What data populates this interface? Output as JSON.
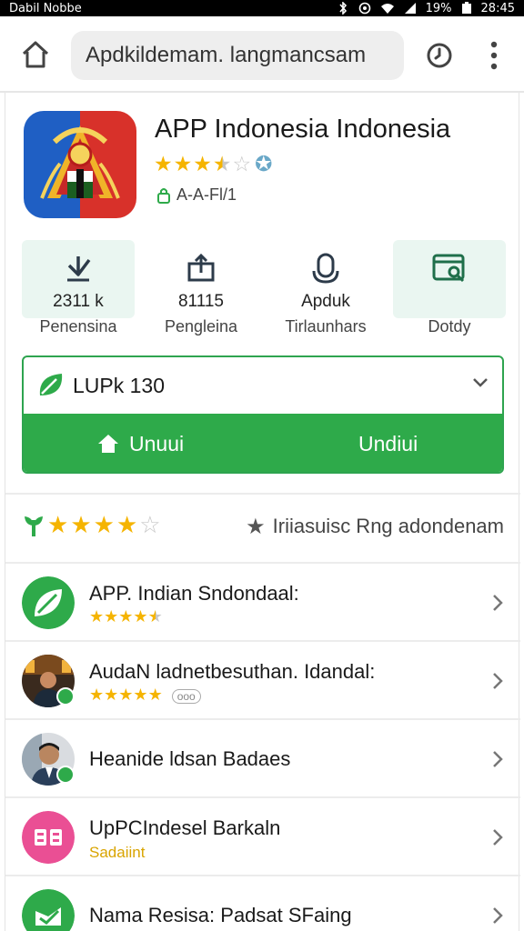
{
  "status_bar": {
    "carrier": "Dabil Nobbe",
    "battery": "19%",
    "time": "28:45"
  },
  "browser": {
    "url": "Apdkildemam. langmancsam"
  },
  "app": {
    "title": "APP Indonesia Indonesia",
    "rating": 3.5,
    "meta": "A-A-Fl/1"
  },
  "stats": [
    {
      "value": "2311 k",
      "label": "Penensina",
      "icon": "download-icon"
    },
    {
      "value": "81115",
      "label": "Pengleina",
      "icon": "share-icon"
    },
    {
      "value": "Apduk",
      "label": "Tirlaunhars",
      "icon": "microphone-icon"
    },
    {
      "value": "",
      "label": "Dotdy",
      "icon": "document-search-icon"
    }
  ],
  "version": {
    "label": "LUPk 130"
  },
  "actions": {
    "primary_label": "Unuui",
    "secondary_label": "Undiui"
  },
  "rating_row": {
    "stars": 4,
    "right_text": "Iriiasuisc Rng adondenam"
  },
  "list": [
    {
      "title": "APP. Indian Sndondaal:",
      "stars": 4.5,
      "subtext": "",
      "tag": "",
      "avatar": "leaf-logo"
    },
    {
      "title": "AudaN ladnetbesuthan. Idandal:",
      "stars": 5,
      "subtext": "",
      "tag": "ooo",
      "avatar": "photo-stage"
    },
    {
      "title": "Heanide ldsan Badaes",
      "stars": 0,
      "subtext": "",
      "tag": "",
      "avatar": "photo-person"
    },
    {
      "title": "UpPCIndesel Barkaln",
      "stars": 0,
      "subtext": "Sadaiint",
      "tag": "",
      "avatar": "grid-logo"
    },
    {
      "title": "Nama Resisa: Padsat SFaing",
      "stars": 0,
      "subtext": "",
      "tag": "",
      "avatar": "check-logo"
    }
  ],
  "colors": {
    "accent": "#2eaa4a",
    "star": "#f5b400",
    "tint": "#eaf6f1"
  }
}
